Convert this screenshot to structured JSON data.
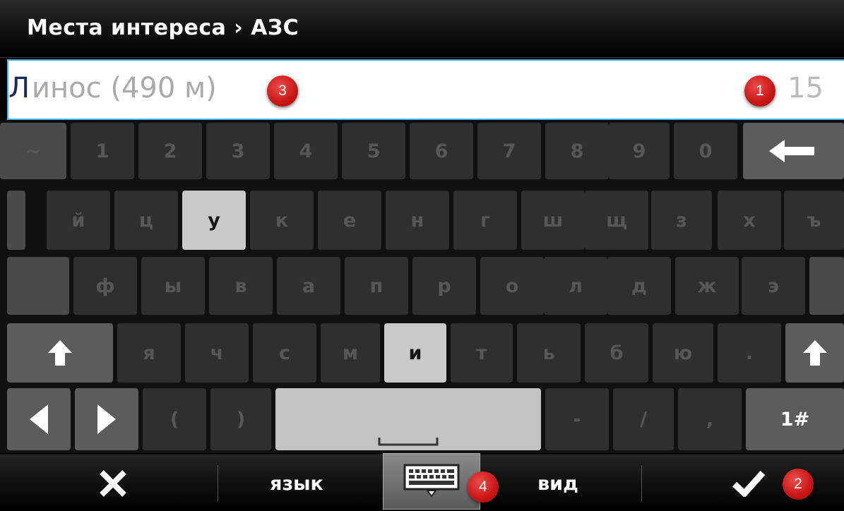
{
  "header": {
    "title": "Места интереса › АЗС"
  },
  "search": {
    "typed": "Л",
    "suggestion": "инос (490 м)",
    "result_count": "15"
  },
  "badges": {
    "b1": "1",
    "b2": "2",
    "b3": "3",
    "b4": "4"
  },
  "keyboard": {
    "row_numbers": [
      "~",
      "1",
      "2",
      "3",
      "4",
      "5",
      "6",
      "7",
      "8",
      "9",
      "0"
    ],
    "row_top": [
      "й",
      "ц",
      "у",
      "к",
      "е",
      "н",
      "г",
      "ш",
      "щ",
      "з",
      "х",
      "ъ"
    ],
    "row_mid": [
      "ф",
      "ы",
      "в",
      "а",
      "п",
      "р",
      "о",
      "л",
      "д",
      "ж",
      "э"
    ],
    "row_low": [
      "я",
      "ч",
      "с",
      "м",
      "и",
      "т",
      "ь",
      "б",
      "ю",
      "."
    ],
    "row_bottom": [
      "(",
      ")",
      "-",
      "/",
      ","
    ],
    "symbols_label": "1#"
  },
  "toolbar": {
    "language_label": "язык",
    "view_label": "вид"
  },
  "icons": {
    "backspace": "backspace-arrow-icon",
    "shift": "shift-arrow-icon",
    "left": "cursor-left-icon",
    "right": "cursor-right-icon",
    "space": "space-bar-icon",
    "close": "close-x-icon",
    "keyboard": "keyboard-icon",
    "confirm": "checkmark-icon"
  },
  "colors": {
    "accent_border": "#4ab0e8",
    "badge_red": "#cc1a1a",
    "highlight_key": "#c9c9c9"
  }
}
